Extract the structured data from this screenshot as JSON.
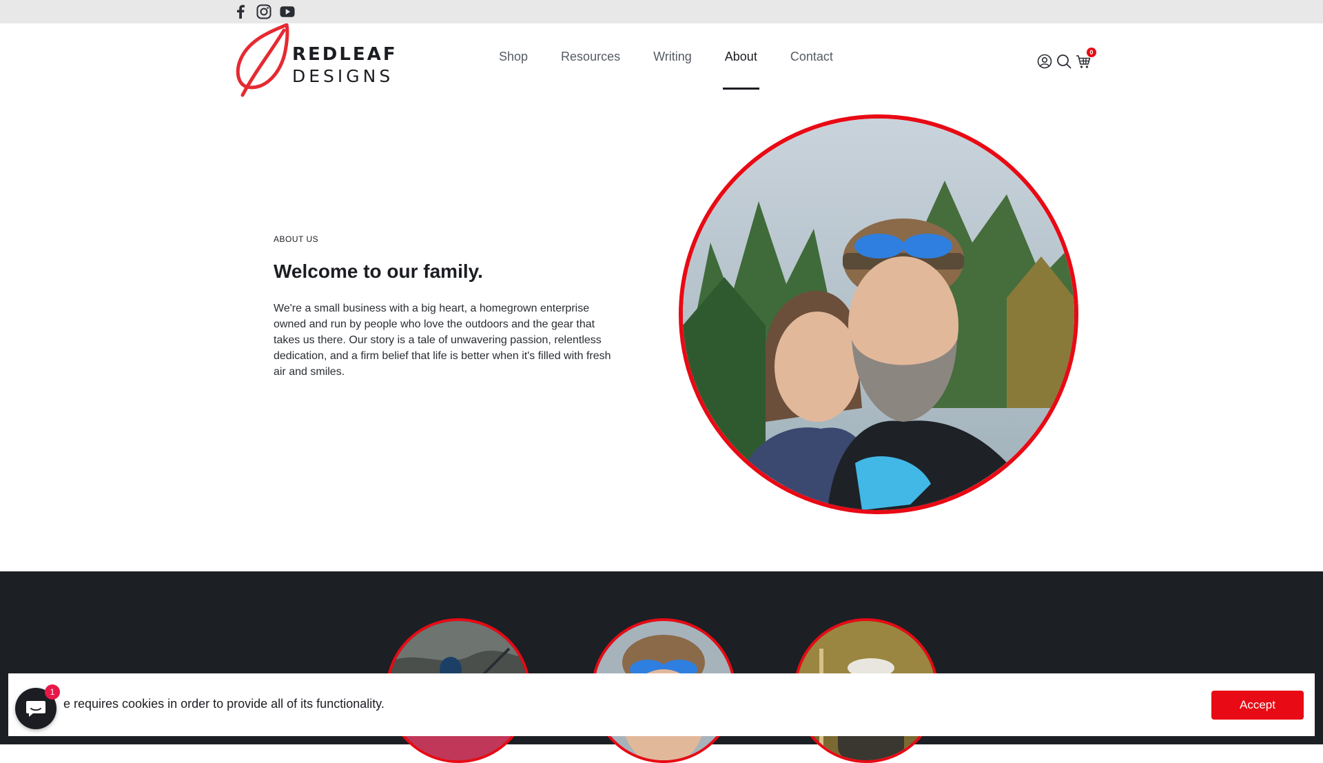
{
  "topbar": {
    "social": [
      {
        "icon": "facebook-icon"
      },
      {
        "icon": "instagram-icon"
      },
      {
        "icon": "youtube-icon"
      }
    ]
  },
  "logo": {
    "line1": "REDLEAF",
    "line2": "DESIGNS",
    "accent": "#e52a32"
  },
  "nav": {
    "items": [
      {
        "label": "Shop"
      },
      {
        "label": "Resources"
      },
      {
        "label": "Writing"
      },
      {
        "label": "About",
        "active": true
      },
      {
        "label": "Contact"
      }
    ]
  },
  "header_icons": {
    "account": "account-icon",
    "search": "search-icon",
    "cart": "cart-icon",
    "cart_count": "0"
  },
  "hero": {
    "eyebrow": "ABOUT US",
    "title": "Welcome to our family.",
    "body": "We're a small business with a big heart, a homegrown enterprise owned and run by people who love the outdoors and the gear that takes us there. Our story is a tale of unwavering passion, relentless dedication, and a firm belief that life is better when it's filled with fresh air and smiles."
  },
  "cookie": {
    "text": "e requires cookies in order to provide all of its functionality.",
    "accept_label": "Accept"
  },
  "chat": {
    "badge": "1"
  },
  "colors": {
    "accent_red": "#e80a14",
    "dark_bg": "#1c1f24",
    "topbar_bg": "#e8e8e8"
  }
}
